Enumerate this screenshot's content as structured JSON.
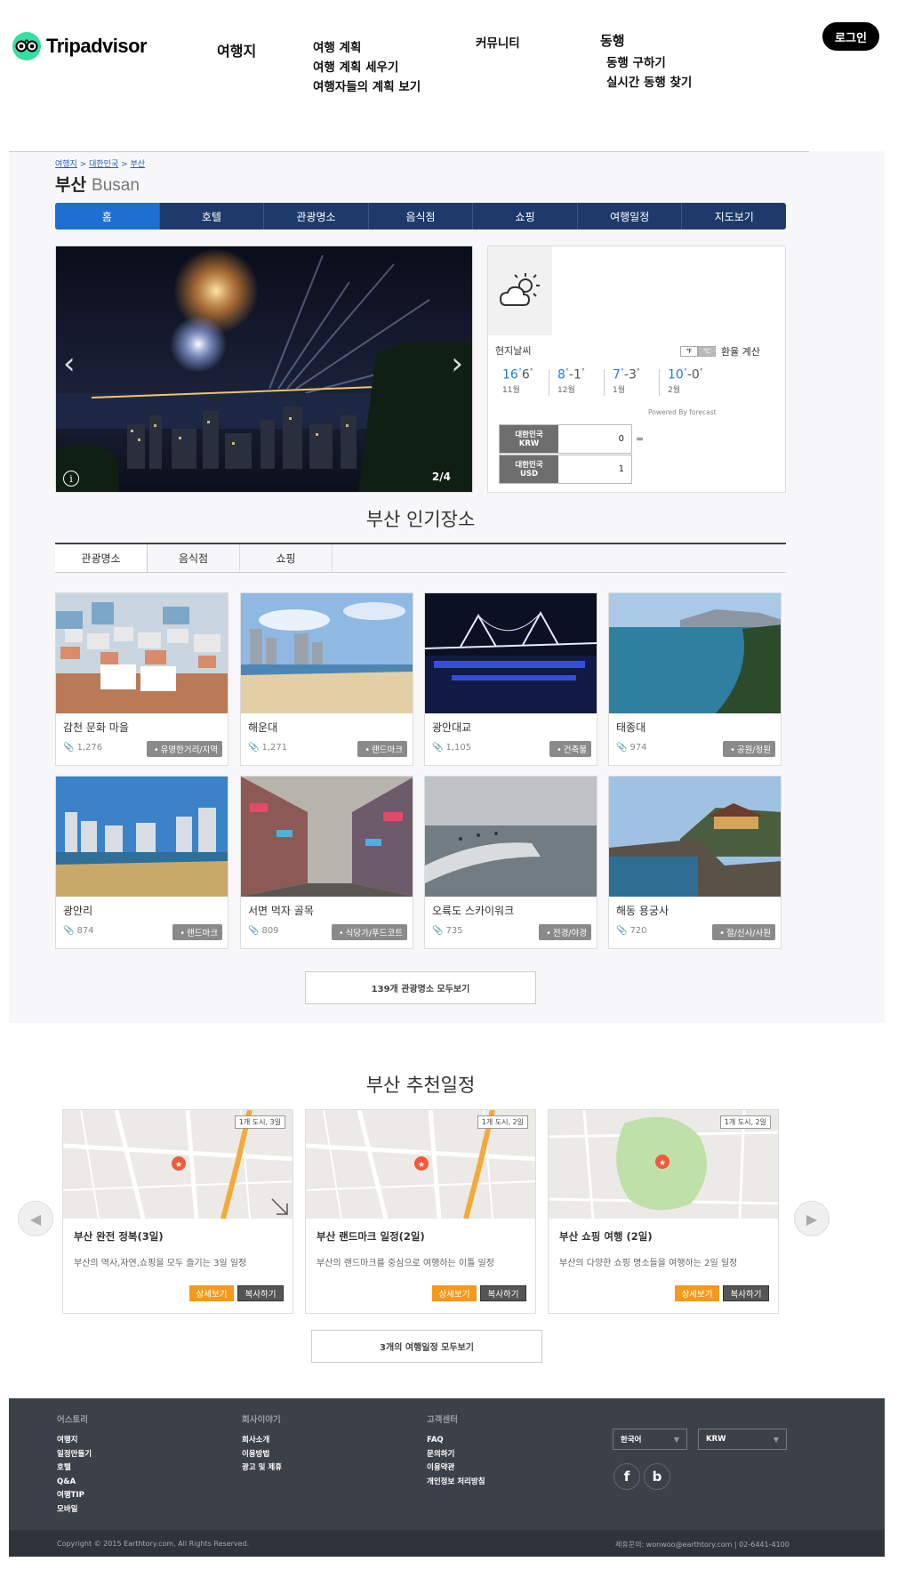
{
  "header": {
    "brand": "Tripadvisor",
    "nav": {
      "destinations": "여행지",
      "plan": {
        "title": "여행 계획",
        "items": [
          "여행 계획 세우기",
          "여행자들의 계획 보기"
        ]
      },
      "community": "커뮤니티",
      "companion": {
        "title": "동행",
        "items": [
          "동행 구하기",
          "실시간 동행 찾기"
        ]
      }
    },
    "login": "로그인"
  },
  "breadcrumb": [
    "여행지",
    "대한민국",
    "부산"
  ],
  "city": {
    "name_ko": "부산",
    "name_en": "Busan"
  },
  "tabs": [
    "홈",
    "호텔",
    "관광명소",
    "음식점",
    "쇼핑",
    "여행일정",
    "지도보기"
  ],
  "slideshow": {
    "counter": "2/4",
    "info_icon": "i"
  },
  "weather": {
    "icon": "partly-cloudy-icon",
    "local_label": "현지날씨",
    "unit_f": "℉",
    "unit_c": "℃",
    "fx_label": "환율 계산",
    "forecast": [
      {
        "hi": "16",
        "lo": "6",
        "month": "11월"
      },
      {
        "hi": "8",
        "lo": "-1",
        "month": "12월"
      },
      {
        "hi": "7",
        "lo": "-3",
        "month": "1월"
      },
      {
        "hi": "10",
        "lo": "-0",
        "month": "2월"
      }
    ],
    "degree": "°",
    "powered": "Powered By forecast",
    "currencies": [
      {
        "country": "대한민국",
        "code": "KRW",
        "value": "0"
      },
      {
        "country": "대한민국",
        "code": "USD",
        "value": "1"
      }
    ],
    "equals": "="
  },
  "popular": {
    "title": "부산 인기장소",
    "tabs": [
      "관광명소",
      "음식점",
      "쇼핑"
    ],
    "cards": [
      {
        "name": "감천 문화 마을",
        "count": "1,276",
        "tag": "유명한거리/지역"
      },
      {
        "name": "해운대",
        "count": "1,271",
        "tag": "랜드마크"
      },
      {
        "name": "광안대교",
        "count": "1,105",
        "tag": "건축물"
      },
      {
        "name": "태종대",
        "count": "974",
        "tag": "공원/정원"
      },
      {
        "name": "광안리",
        "count": "874",
        "tag": "랜드마크"
      },
      {
        "name": "서면 먹자 골목",
        "count": "809",
        "tag": "식당가/푸드코트"
      },
      {
        "name": "오륙도 스카이워크",
        "count": "735",
        "tag": "전경/야경"
      },
      {
        "name": "해동 용궁사",
        "count": "720",
        "tag": "절/신사/사원"
      }
    ],
    "more": "139개 관광명소 모두보기"
  },
  "itineraries": {
    "title": "부산 추천일정",
    "items": [
      {
        "badge": "1개 도시, 3일",
        "title": "부산 완전 정복(3일)",
        "desc": "부산의 역사,자연,쇼핑을 모두 즐기는 3일 일정",
        "detail": "상세보기",
        "copy": "복사하기"
      },
      {
        "badge": "1개 도시, 2일",
        "title": "부산 랜드마크 일정(2일)",
        "desc": "부산의 랜드마크를 중심으로 여행하는 이틀 일정",
        "detail": "상세보기",
        "copy": "복사하기"
      },
      {
        "badge": "1개 도시, 2일",
        "title": "부산 쇼핑 여행 (2일)",
        "desc": "부산의 다양한 쇼핑 명소들을 여행하는 2일 일정",
        "detail": "상세보기",
        "copy": "복사하기"
      }
    ],
    "more": "3개의 여행일정 모두보기"
  },
  "footer": {
    "columns": [
      {
        "head": "어스토리",
        "items": [
          "여행지",
          "일정만들기",
          "호텔",
          "Q&A",
          "여행TIP",
          "모바일"
        ]
      },
      {
        "head": "회사이야기",
        "items": [
          "회사소개",
          "이용방법",
          "광고 및 제휴"
        ]
      },
      {
        "head": "고객센터",
        "items": [
          "FAQ",
          "문의하기",
          "이용약관",
          "개인정보 처리방침"
        ]
      }
    ],
    "language": "한국어",
    "currency": "KRW",
    "copyright": "Copyright © 2015 Earthtory.com, All Rights Reserved.",
    "contact": "제휴문의: wonwoo@earthtory.com | 02-6441-4100"
  },
  "colors": {
    "accent": "#1d6fd2",
    "nav": "#1e3a6b",
    "orange": "#f39a1d",
    "footer": "#3c4049",
    "brand": "#34e0a1"
  }
}
